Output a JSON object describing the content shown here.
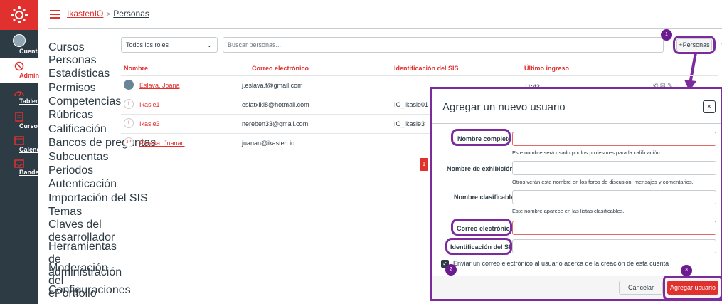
{
  "nav": {
    "items": [
      {
        "label": "Cuenta"
      },
      {
        "label": "Admin"
      },
      {
        "label": "Tablero"
      },
      {
        "label": "Cursos"
      },
      {
        "label": "Calendario"
      },
      {
        "label": "Bandeja de entrada"
      }
    ]
  },
  "breadcrumb": {
    "root": "IkastenIO",
    "separator": ">",
    "current": "Personas"
  },
  "course_nav": [
    "Cursos",
    "Personas",
    "Estadísticas",
    "Permisos",
    "Competencias",
    "Rúbricas",
    "Calificación",
    "Bancos de preguntas",
    "Subcuentas",
    "Periodos",
    "Autenticación",
    "Importación del SIS",
    "Temas",
    "Claves del desarrollador",
    "Herramientas de administración",
    "Moderación del ePortfolio",
    "Configuraciones"
  ],
  "filters": {
    "role_select": "Todos los roles",
    "search_placeholder": "Buscar personas...",
    "add_people": "+Personas"
  },
  "table": {
    "headers": [
      "Nombre",
      "Correo electrónico",
      "Identificación del SIS",
      "Último ingreso"
    ],
    "rows": [
      {
        "name": "Eslava, Joana",
        "email": "j.eslava.f@gmail.com",
        "sis": "",
        "last": "11:43",
        "initials": ""
      },
      {
        "name": "Ikasle1",
        "email": "eslatxiki8@hotmail.com",
        "sis": "IO_Ikasle01",
        "last": "",
        "initials": "I"
      },
      {
        "name": "Ikasle3",
        "email": "nereben33@gmail.com",
        "sis": "IO_Ikasle3",
        "last": "",
        "initials": "I"
      },
      {
        "name": "Pereira, Juanan",
        "email": "juanan@ikasten.io",
        "sis": "",
        "last": "",
        "initials": "JP"
      }
    ]
  },
  "annotations": {
    "one": "1",
    "two": "2",
    "three": "3",
    "red_badge": "1"
  },
  "dialog": {
    "title": "Agregar un nuevo usuario",
    "close": "×",
    "fields": [
      {
        "label": "Nombre completo",
        "hint": "Este nombre será usado por los profesores para la calificación."
      },
      {
        "label": "Nombre de exhibición",
        "hint": "Otros verán este nombre en los foros de discusión, mensajes y comentarios."
      },
      {
        "label": "Nombre clasificable",
        "hint": "Este nombre aparece en las listas clasificables."
      },
      {
        "label": "Correo electrónico",
        "hint": ""
      },
      {
        "label": "Identificación del SIS",
        "hint": ""
      }
    ],
    "checkbox_label": "Enviar un correo electrónico al usuario acerca de la creación de esta cuenta",
    "cancel": "Cancelar",
    "submit": "Agregar usuario"
  },
  "colors": {
    "brand": "#e0312f",
    "nav_bg": "#2d3b45",
    "annotation": "#7c2b9c"
  }
}
